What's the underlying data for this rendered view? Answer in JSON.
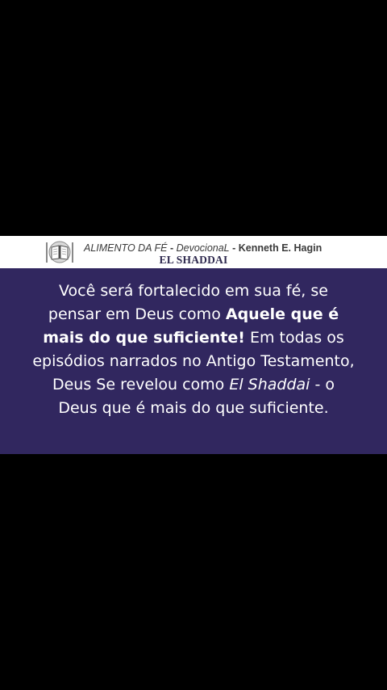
{
  "header": {
    "logo_icon": "bible-book-icon",
    "publication": "ALIMENTO DA FÉ",
    "sep1": " - ",
    "kind": "DevocionaL",
    "sep2": " - ",
    "author": "Kenneth E. Hagin",
    "title": "EL SHADDAI"
  },
  "devotional": {
    "part1": "Você será fortalecido em sua fé, se pensar em Deus como ",
    "emphasis": "Aquele que é mais do que suficiente!",
    "part2": " Em todas os episódios narrados no Antigo Testamento, Deus Se revelou como ",
    "name": "El Shaddai",
    "part3": " - o Deus que é mais do que suficiente."
  },
  "colors": {
    "background": "#000000",
    "header_bg": "#ffffff",
    "panel_bg": "#31275f",
    "text": "#ffffff",
    "title": "#2f2a4f"
  }
}
